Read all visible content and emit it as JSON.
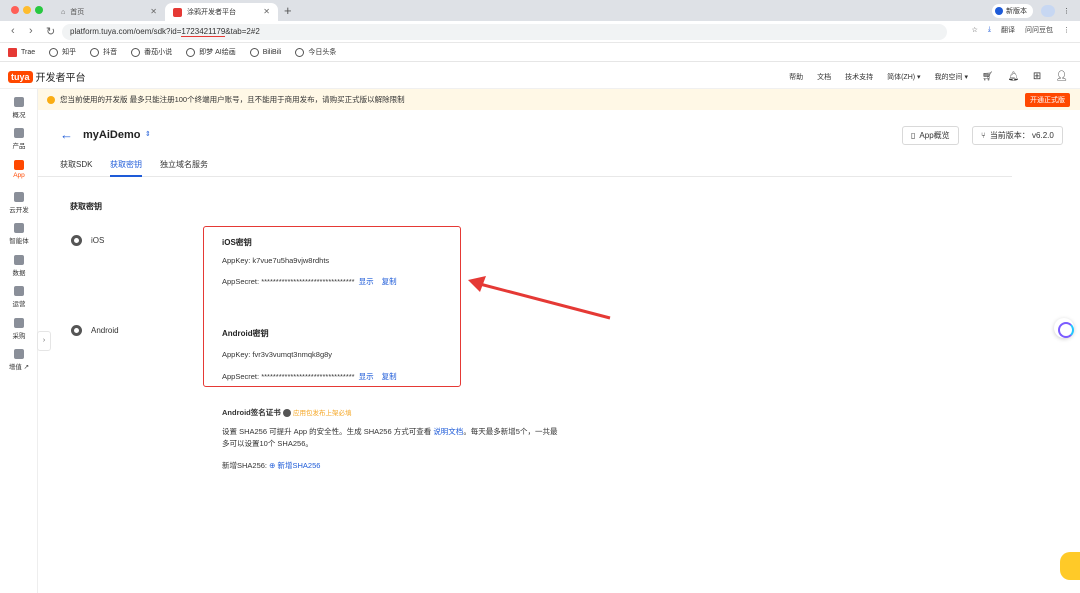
{
  "browser": {
    "tabs": [
      {
        "label": "首页"
      },
      {
        "label": "涂鸦开发者平台"
      }
    ],
    "new_version": "新版本",
    "url_prefix": "platform.tuya.com/oem/sdk?id=",
    "url_id": "1723421179",
    "url_suffix": "&tab=2#2",
    "translate": "翻译",
    "profile": "问问豆包",
    "bookmarks": [
      "Trae",
      "知乎",
      "抖音",
      "番茄小说",
      "即梦 AI绘画",
      "BiliBili",
      "今日头条"
    ]
  },
  "appbar": {
    "brand": "tuya",
    "platform": "开发者平台",
    "nav": [
      "帮助",
      "文档",
      "技术支持",
      "简体(ZH)",
      "我的空间"
    ]
  },
  "sidebar": {
    "items": [
      {
        "label": "概况",
        "icon": "home-icon"
      },
      {
        "label": "产品",
        "icon": "product-icon"
      },
      {
        "label": "App",
        "icon": "app-icon"
      },
      {
        "label": "云开发",
        "icon": "cloud-icon"
      },
      {
        "label": "智能体",
        "icon": "agent-icon"
      },
      {
        "label": "数据",
        "icon": "chart-icon"
      },
      {
        "label": "运营",
        "icon": "operate-icon"
      },
      {
        "label": "采购",
        "icon": "purchase-icon"
      },
      {
        "label": "增值",
        "icon": "value-added-icon"
      }
    ]
  },
  "notice": {
    "text": "您当前使用的开发版 最多只能注册100个终端用户账号，且不能用于商用发布，请购买正式版以解除限制",
    "button": "开通正式版"
  },
  "header": {
    "app_name": "myAiDemo",
    "overview_btn": "App概览",
    "version_btn": "当前版本： v6.2.0"
  },
  "tabs": [
    "获取SDK",
    "获取密钥",
    "独立域名服务"
  ],
  "section_title": "获取密钥",
  "ios": {
    "platform": "iOS",
    "title": "iOS密钥",
    "appkey": "AppKey: k7vue7u5ha9vjw8rdhts",
    "appsecret": "AppSecret: ********************************",
    "show": "显示",
    "copy": "复制"
  },
  "android": {
    "platform": "Android",
    "title": "Android密钥",
    "appkey": "AppKey: fvr3v3vumqt3nmqk8g8y",
    "appsecret": "AppSecret: ********************************",
    "show": "显示",
    "copy": "复制"
  },
  "signature": {
    "title": "Android签名证书",
    "required": "应用包发布上架必填",
    "desc1_a": "设置 SHA256 可提升 App 的安全性。生成 SHA256 方式可查看 ",
    "desc1_link": "说明文档",
    "desc1_b": "。每天最多新增5个，一共最",
    "desc2": "多可以设置10个 SHA256。",
    "add_label": "新增SHA256:",
    "add_link": "新增SHA256"
  },
  "colors": {
    "accent": "#1e5bd8",
    "brand": "#ff4800",
    "highlight": "#e53935"
  }
}
